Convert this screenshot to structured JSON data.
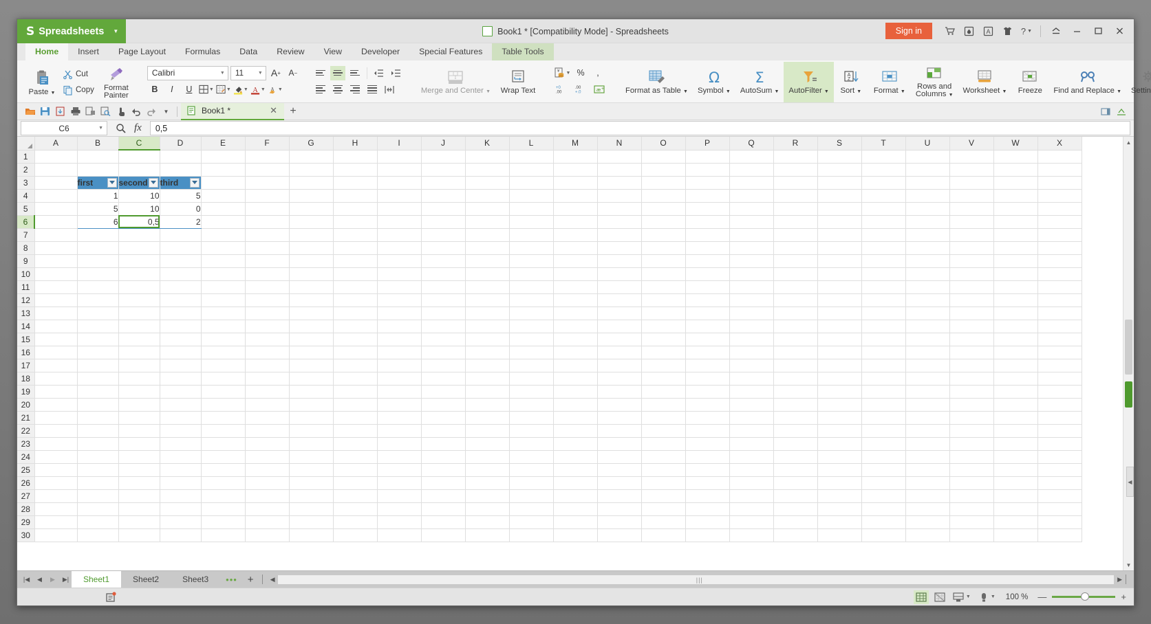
{
  "titlebar": {
    "brand": "Spreadsheets",
    "document_title": "Book1 * [Compatibility Mode] - Spreadsheets",
    "signin_label": "Sign in",
    "icons": [
      "cart-icon",
      "drop-icon",
      "app-icon",
      "shirt-icon",
      "help-icon"
    ],
    "window_controls": [
      "collapse-ribbon-icon",
      "minimize-icon",
      "maximize-icon",
      "close-icon"
    ]
  },
  "ribbon_tabs": [
    {
      "label": "Home",
      "state": "active"
    },
    {
      "label": "Insert",
      "state": "normal"
    },
    {
      "label": "Page Layout",
      "state": "normal"
    },
    {
      "label": "Formulas",
      "state": "normal"
    },
    {
      "label": "Data",
      "state": "normal"
    },
    {
      "label": "Review",
      "state": "normal"
    },
    {
      "label": "View",
      "state": "normal"
    },
    {
      "label": "Developer",
      "state": "normal"
    },
    {
      "label": "Special Features",
      "state": "normal"
    },
    {
      "label": "Table Tools",
      "state": "contextual"
    }
  ],
  "ribbon": {
    "paste": "Paste",
    "cut": "Cut",
    "copy": "Copy",
    "format_painter": "Format Painter",
    "font_name": "Calibri",
    "font_size": "11",
    "grow_font": "A",
    "shrink_font": "A",
    "bold": "B",
    "italic": "I",
    "underline": "U",
    "merge_center": "Merge and Center",
    "wrap_text": "Wrap Text",
    "percent": "%",
    "comma": ",",
    "inc_decimal": ".00",
    "dec_decimal": ".0",
    "format_as_table": "Format as Table",
    "symbol": "Symbol",
    "autosum": "AutoSum",
    "autofilter": "AutoFilter",
    "sort": "Sort",
    "format": "Format",
    "rows_and_columns": "Rows and Columns",
    "worksheet": "Worksheet",
    "freeze": "Freeze",
    "find_and_replace": "Find and Replace",
    "settings": "Settings"
  },
  "quick_access": {
    "icons": [
      "open-icon",
      "save-icon",
      "export-pdf-icon",
      "print-icon",
      "print-direct-icon",
      "print-preview-icon",
      "touch-icon",
      "undo-icon",
      "redo-icon",
      "customize-caret-icon"
    ],
    "doc_tab": "Book1 *",
    "new_tab": "+"
  },
  "formula_bar": {
    "name_box": "C6",
    "value": "0,5",
    "fx_label": "fx"
  },
  "grid": {
    "columns": [
      "A",
      "B",
      "C",
      "D",
      "E",
      "F",
      "G",
      "H",
      "I",
      "J",
      "K",
      "L",
      "M",
      "N",
      "O",
      "P",
      "Q",
      "R",
      "S",
      "T",
      "U",
      "V",
      "W",
      "X"
    ],
    "active_column": "C",
    "active_row": 6,
    "selected_cell": "C6",
    "rows": [
      1,
      2,
      3,
      4,
      5,
      6,
      7,
      8,
      9,
      10,
      11,
      12,
      13,
      14,
      15,
      16,
      17,
      18,
      19,
      20,
      21,
      22,
      23,
      24,
      25,
      26,
      27,
      28,
      29,
      30
    ],
    "table": {
      "header_row": 3,
      "start_col": "B",
      "headers": [
        "first",
        "second",
        "third"
      ],
      "data": [
        [
          "1",
          "10",
          "5"
        ],
        [
          "5",
          "10",
          "0"
        ],
        [
          "6",
          "0,5",
          "2"
        ]
      ],
      "data_rows": [
        4,
        5,
        6
      ]
    }
  },
  "sheet_tabs": {
    "tabs": [
      {
        "label": "Sheet1",
        "active": true
      },
      {
        "label": "Sheet2",
        "active": false
      },
      {
        "label": "Sheet3",
        "active": false
      }
    ],
    "nav": [
      "first-sheet-icon",
      "prev-sheet-icon",
      "next-sheet-icon",
      "last-sheet-icon"
    ],
    "more": "•••",
    "add": "+"
  },
  "status_bar": {
    "zoom_level": "100 %",
    "view_buttons": [
      "normal-view-icon",
      "page-break-view-icon",
      "page-layout-icon",
      "reading-layout-icon"
    ],
    "zoom_out": "—",
    "zoom_in": "+"
  },
  "colors": {
    "brand_green": "#62a83b",
    "signin_orange": "#e8613c",
    "table_header_blue": "#4a90c4",
    "selection_green": "#4f9a2e"
  }
}
